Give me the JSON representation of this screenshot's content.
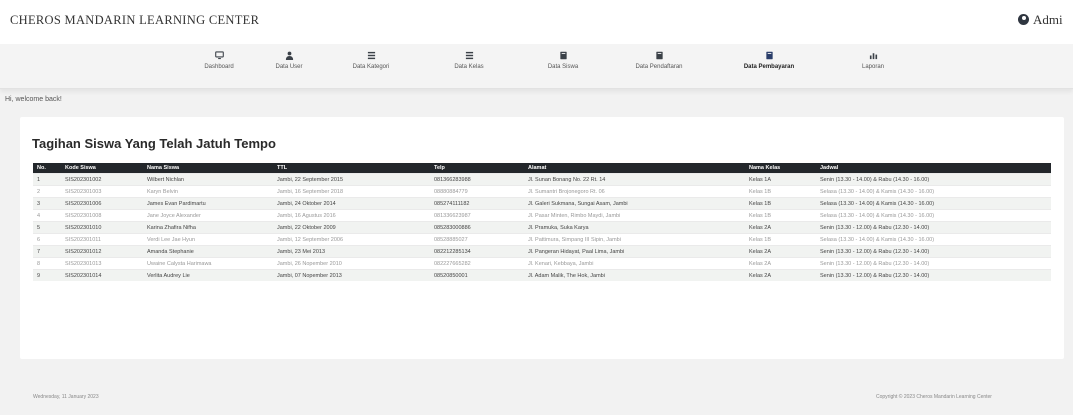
{
  "header": {
    "brand": "CHEROS MANDARIN LEARNING CENTER",
    "user": "Admi"
  },
  "nav": {
    "items": [
      {
        "label": "Dashboard",
        "icon": "desktop-icon"
      },
      {
        "label": "Data User",
        "icon": "user-icon"
      },
      {
        "label": "Data Kategori",
        "icon": "list-icon"
      },
      {
        "label": "Data Kelas",
        "icon": "list-icon"
      },
      {
        "label": "Data Siswa",
        "icon": "book-icon"
      },
      {
        "label": "Data Pendaftaran",
        "icon": "book-icon"
      },
      {
        "label": "Data Pembayaran",
        "icon": "book-icon"
      },
      {
        "label": "Laporan",
        "icon": "chart-icon"
      }
    ],
    "active_index": 6
  },
  "welcome": "Hi, welcome back!",
  "card": {
    "title": "Tagihan Siswa Yang Telah Jatuh Tempo",
    "columns": [
      "No.",
      "Kode Siswa",
      "Nama Siswa",
      "TTL",
      "Telp",
      "Alamat",
      "Nama Kelas",
      "Jadwal"
    ],
    "rows": [
      [
        "1",
        "SIS202301002",
        "Wilbert Nichlan",
        "Jambi, 22 September 2015",
        "081366283988",
        "Jl. Sunan Bonang No. 22 Rt. 14",
        "Kelas 1A",
        "Senin (13.30 - 14.00) & Rabu (14.30 - 16.00)"
      ],
      [
        "2",
        "SIS202301003",
        "Karyn Belvin",
        "Jambi, 16 September 2018",
        "08880884779",
        "Jl. Sumantri Brojonegoro Rt. 06",
        "Kelas 1B",
        "Selasa (13.30 - 14.00) & Kamis (14.30 - 16.00)"
      ],
      [
        "3",
        "SIS202301006",
        "James Evan Pardimartu",
        "Jambi, 24 Oktober 2014",
        "085274111182",
        "Jl. Galeri Sukmana, Sungai Asam, Jambi",
        "Kelas 1B",
        "Selasa (13.30 - 14.00) & Kamis (14.30 - 16.00)"
      ],
      [
        "4",
        "SIS202301008",
        "Jane Joyce Alexander",
        "Jambi, 16 Agustus 2016",
        "081336623987",
        "Jl. Pasar Minten, Rimbo Maydi, Jambi",
        "Kelas 1B",
        "Selasa (13.30 - 14.00) & Kamis (14.30 - 16.00)"
      ],
      [
        "5",
        "SIS202301010",
        "Karina Zhafira Nifha",
        "Jambi, 22 Oktober 2009",
        "085283000886",
        "Jl. Pramuka, Suka Karya",
        "Kelas 2A",
        "Senin (13.30 - 12.00) & Rabu (12.30 - 14.00)"
      ],
      [
        "6",
        "SIS202301011",
        "Verdi Lee Jae Hyun",
        "Jambi, 12 September 2006",
        "08528885027",
        "Jl. Pattimura, Simpang III Sipin, Jambi",
        "Kelas 1B",
        "Selasa (13.30 - 14.00) & Kamis (14.30 - 16.00)"
      ],
      [
        "7",
        "SIS202301012",
        "Amanda Stephanie",
        "Jambi, 23 Mei 2013",
        "082212285134",
        "Jl. Pangeran Hidayat, Paal Lima, Jambi",
        "Kelas 2A",
        "Senin (13.30 - 12.00) & Rabu (12.30 - 14.00)"
      ],
      [
        "8",
        "SIS202301013",
        "Uwaine Calysta Harimawa",
        "Jambi, 26 Nopember 2010",
        "082227665282",
        "Jl. Kenari, Kebbaya, Jambi",
        "Kelas 2A",
        "Senin (13.30 - 12.00) & Rabu (12.30 - 14.00)"
      ],
      [
        "9",
        "SIS202301014",
        "Verlita Audrey Lie",
        "Jambi, 07 Nopember 2013",
        "08520850001",
        "Jl. Adam Malik, The Hok, Jambi",
        "Kelas 2A",
        "Senin (13.30 - 12.00) & Rabu (12.30 - 14.00)"
      ]
    ]
  },
  "footer": {
    "date": "Wednesday, 11 January 2023",
    "copyright": "Copyright © 2023 Cheros Mandarin Learning Center"
  }
}
